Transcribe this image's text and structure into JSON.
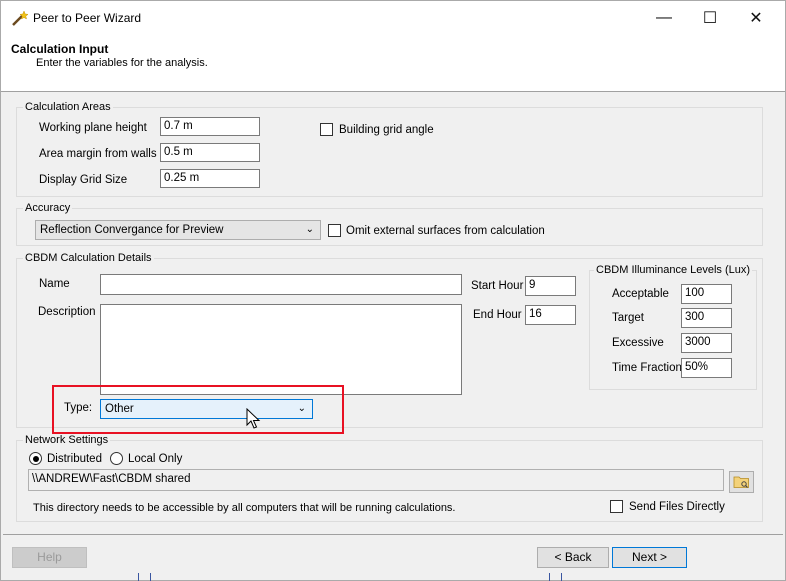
{
  "window": {
    "title": "Peer to Peer Wizard",
    "minimize_glyph": "—",
    "maximize_glyph": "☐",
    "close_glyph": "✕"
  },
  "header": {
    "title": "Calculation Input",
    "subtitle": "Enter the variables for the analysis."
  },
  "calc_areas": {
    "legend": "Calculation Areas",
    "working_plane_label": "Working plane height",
    "working_plane_value": "0.7 m",
    "area_margin_label": "Area margin from walls",
    "area_margin_value": "0.5 m",
    "grid_size_label": "Display Grid Size",
    "grid_size_value": "0.25 m",
    "building_grid_label": "Building grid angle"
  },
  "accuracy": {
    "legend": "Accuracy",
    "selected": "Reflection Convergance for Preview",
    "omit_label": "Omit external surfaces from calculation"
  },
  "cbdm": {
    "legend": "CBDM Calculation Details",
    "name_label": "Name",
    "name_value": "",
    "description_label": "Description",
    "description_value": "",
    "start_hour_label": "Start Hour",
    "start_hour_value": "9",
    "end_hour_label": "End Hour",
    "end_hour_value": "16",
    "type_label": "Type:",
    "type_value": "Other"
  },
  "illuminance": {
    "legend": "CBDM Illuminance Levels (Lux)",
    "acceptable_label": "Acceptable",
    "acceptable_value": "100",
    "target_label": "Target",
    "target_value": "300",
    "excessive_label": "Excessive",
    "excessive_value": "3000",
    "time_fraction_label": "Time Fraction",
    "time_fraction_value": "50%"
  },
  "network": {
    "legend": "Network Settings",
    "distributed_label": "Distributed",
    "local_label": "Local Only",
    "path_value": "\\\\ANDREW\\Fast\\CBDM shared",
    "note": "This directory needs to be accessible by all computers that will be running calculations.",
    "send_files_label": "Send Files Directly"
  },
  "buttons": {
    "help": "Help",
    "back": "< Back",
    "next": "Next >"
  },
  "colors": {
    "highlight": "#e81123",
    "focus": "#0078d7"
  }
}
